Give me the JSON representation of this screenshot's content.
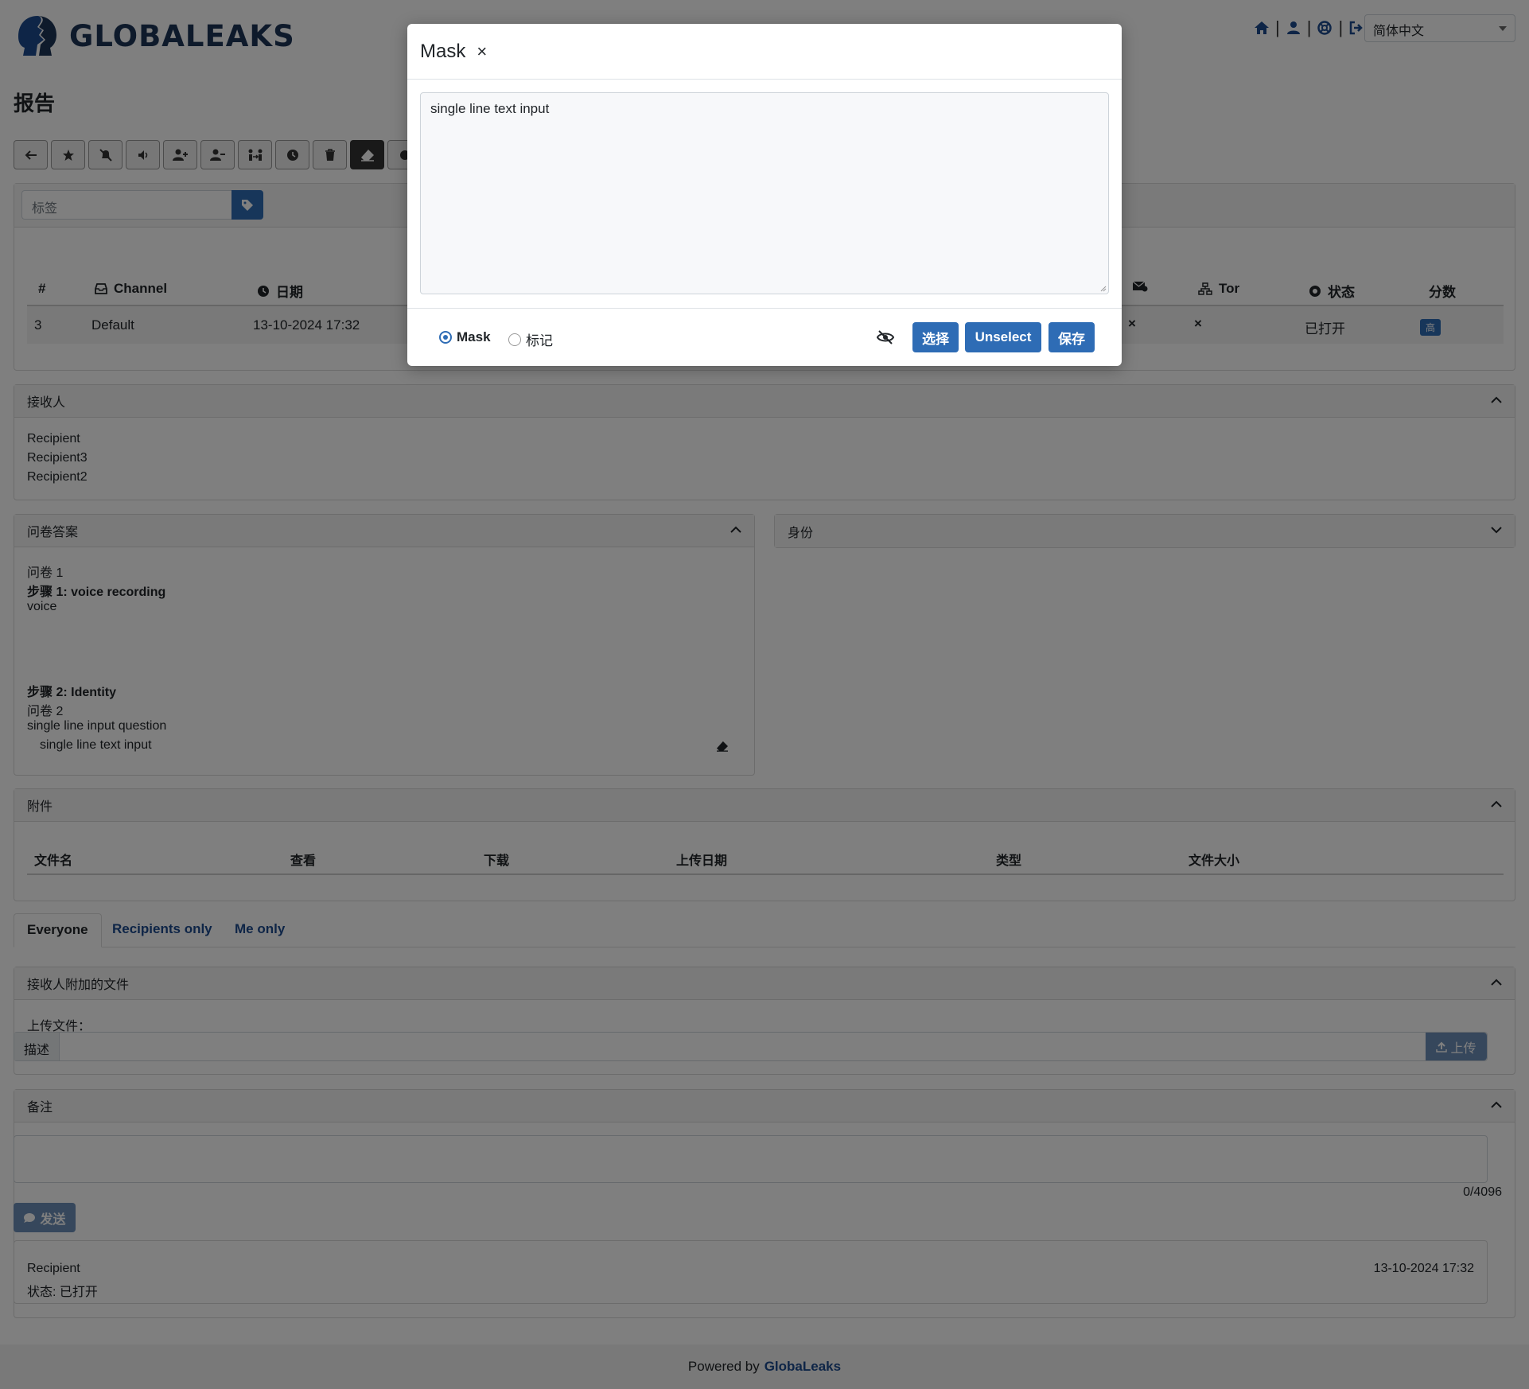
{
  "brand": {
    "name": "GLOBALEAKS"
  },
  "language": {
    "selected": "简体中文"
  },
  "page": {
    "title": "报告"
  },
  "tags": {
    "placeholder": "标签"
  },
  "report_table": {
    "headers": [
      "#",
      "Channel",
      "日期",
      "Tor",
      "状态",
      "分数"
    ],
    "row": {
      "id": "3",
      "channel": "Default",
      "date": "13-10-2024 17:32",
      "mail_flag": "×",
      "tor_flag": "×",
      "status": "已打开",
      "score": "高"
    }
  },
  "recipients": {
    "title": "接收人",
    "items": [
      "Recipient",
      "Recipient3",
      "Recipient2"
    ]
  },
  "answers": {
    "title": "问卷答案",
    "q1_label": "问卷 1",
    "step1": "步骤 1: voice recording",
    "step1_value": "voice",
    "step2": "步骤 2: Identity",
    "q2_label": "问卷 2",
    "question": "single line input question",
    "answer": "single line text input"
  },
  "identity": {
    "title": "身份"
  },
  "attachments": {
    "title": "附件",
    "headers": [
      "文件名",
      "查看",
      "下载",
      "上传日期",
      "类型",
      "文件大小"
    ]
  },
  "tabs": [
    "Everyone",
    "Recipients only",
    "Me only"
  ],
  "recipient_files": {
    "title": "接收人附加的文件",
    "upload_label": "上传文件：",
    "desc": "描述",
    "upload_btn": "上传"
  },
  "notes": {
    "title": "备注",
    "counter": "0/4096",
    "send": "发送"
  },
  "comment": {
    "author": "Recipient",
    "status": "状态: 已打开",
    "date": "13-10-2024 17:32"
  },
  "footer": {
    "prefix": "Powered by",
    "link": "GlobaLeaks"
  },
  "modal": {
    "title": "Mask",
    "close": "×",
    "text": "single line text input",
    "radio_mask": "Mask",
    "radio_mark": "标记",
    "btn_select": "选择",
    "btn_unselect": "Unselect",
    "btn_save": "保存"
  }
}
